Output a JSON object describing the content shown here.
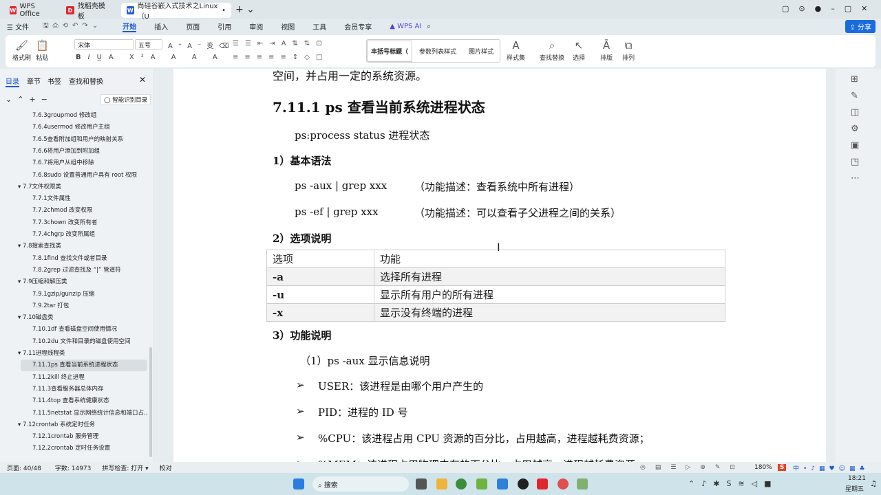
{
  "tabs": [
    {
      "label": "WPS Office"
    },
    {
      "label": "找稻壳模板"
    },
    {
      "label": "尚硅谷嵌入式技术之Linux（U"
    }
  ],
  "menu": {
    "file": "文件",
    "items": [
      "开始",
      "插入",
      "页面",
      "引用",
      "审阅",
      "视图",
      "工具",
      "会员专享"
    ],
    "ai": "WPS AI",
    "share": "分享"
  },
  "ribbon": {
    "format_painter": "格式刷",
    "paste": "粘贴",
    "font": "宋体",
    "size": "五号",
    "styles": [
      "丰括号标题（",
      "参数列表样式",
      "图片样式"
    ],
    "style_set": "样式集",
    "find_replace": "查找替换",
    "select": "选择",
    "layout": "排版",
    "arrange": "排列"
  },
  "sidebar": {
    "tabs": [
      "目录",
      "章节",
      "书签",
      "查找和替换"
    ],
    "smart": "智能识别目录",
    "items": [
      {
        "label": "7.6.3groupmod 修改组",
        "level": 2
      },
      {
        "label": "7.6.4usermod 修改用户主组",
        "level": 2
      },
      {
        "label": "7.6.5查看附加组和用户的映射关系",
        "level": 2
      },
      {
        "label": "7.6.6将用户添加到附加组",
        "level": 2
      },
      {
        "label": "7.6.7将用户从组中移除",
        "level": 2
      },
      {
        "label": "7.6.8sudo 设置普通用户具有 root 权限",
        "level": 2
      },
      {
        "label": "▾ 7.7文件权限类",
        "level": 1
      },
      {
        "label": "7.7.1文件属性",
        "level": 2
      },
      {
        "label": "7.7.2chmod  改变权限",
        "level": 2
      },
      {
        "label": "7.7.3chown 改变所有者",
        "level": 2
      },
      {
        "label": "7.7.4chgrp  改变所属组",
        "level": 2
      },
      {
        "label": "▾ 7.8搜索查找类",
        "level": 1
      },
      {
        "label": "7.8.1find 查找文件或者目录",
        "level": 2
      },
      {
        "label": "7.8.2grep  过滤查找及 “|” 管道符",
        "level": 2
      },
      {
        "label": "▾ 7.9压缩和解压类",
        "level": 1
      },
      {
        "label": "7.9.1gzip/gunzip  压缩",
        "level": 2
      },
      {
        "label": "7.9.2tar  打包",
        "level": 2
      },
      {
        "label": "▾ 7.10磁盘类",
        "level": 1
      },
      {
        "label": "7.10.1df  查看磁盘空间使用情况",
        "level": 2
      },
      {
        "label": "7.10.2du  文件和目录的磁盘使用空间",
        "level": 2
      },
      {
        "label": "▾ 7.11进程线程类",
        "level": 1
      },
      {
        "label": "7.11.1ps  查看当前系统进程状态",
        "level": 2,
        "selected": true
      },
      {
        "label": "7.11.2kill  终止进程",
        "level": 2
      },
      {
        "label": "7.11.3查看服务器总体内存",
        "level": 2
      },
      {
        "label": "7.11.4top 查看系统健康状态",
        "level": 2
      },
      {
        "label": "7.11.5netstat  显示网络统计信息和端口占...",
        "level": 2
      },
      {
        "label": "▾ 7.12crontab  系统定时任务",
        "level": 1
      },
      {
        "label": "7.12.1crontab  服务管理",
        "level": 2
      },
      {
        "label": "7.12.2crontab  定时任务设置",
        "level": 2
      }
    ]
  },
  "doc": {
    "line0": "空间，并占用一定的系统资源。",
    "heading": "7.11.1  ps  查看当前系统进程状态",
    "intro": "ps:process status  进程状态",
    "s1": "1）基本语法",
    "cmd1": "ps -aux | grep xxx",
    "desc1": "（功能描述：查看系统中所有进程）",
    "cmd2": "ps -ef | grep xxx",
    "desc2": "（功能描述：可以查看子父进程之间的关系）",
    "s2": "2）选项说明",
    "table": {
      "headers": [
        "选项",
        "功能"
      ],
      "rows": [
        [
          "-a",
          "选择所有进程"
        ],
        [
          "-u",
          "显示所有用户的所有进程"
        ],
        [
          "-x",
          "显示没有终端的进程"
        ]
      ]
    },
    "s3": "3）功能说明",
    "sub1": "（1）ps -aux 显示信息说明",
    "bullets": [
      "USER：该进程是由哪个用户产生的",
      "PID：进程的 ID 号",
      "%CPU：该进程占用 CPU 资源的百分比，占用越高，进程越耗费资源；",
      "%MEM：该进程占用物理内存的百分比，占用越高，进程越耗费资源"
    ]
  },
  "status": {
    "page": "页面: 40/48",
    "words": "字数: 14973",
    "spell": "拼写检查: 打开 ▾",
    "proof": "校对",
    "zoom": "180%"
  },
  "taskbar": {
    "search": "搜索",
    "time": "18:21",
    "day": "星期五"
  }
}
